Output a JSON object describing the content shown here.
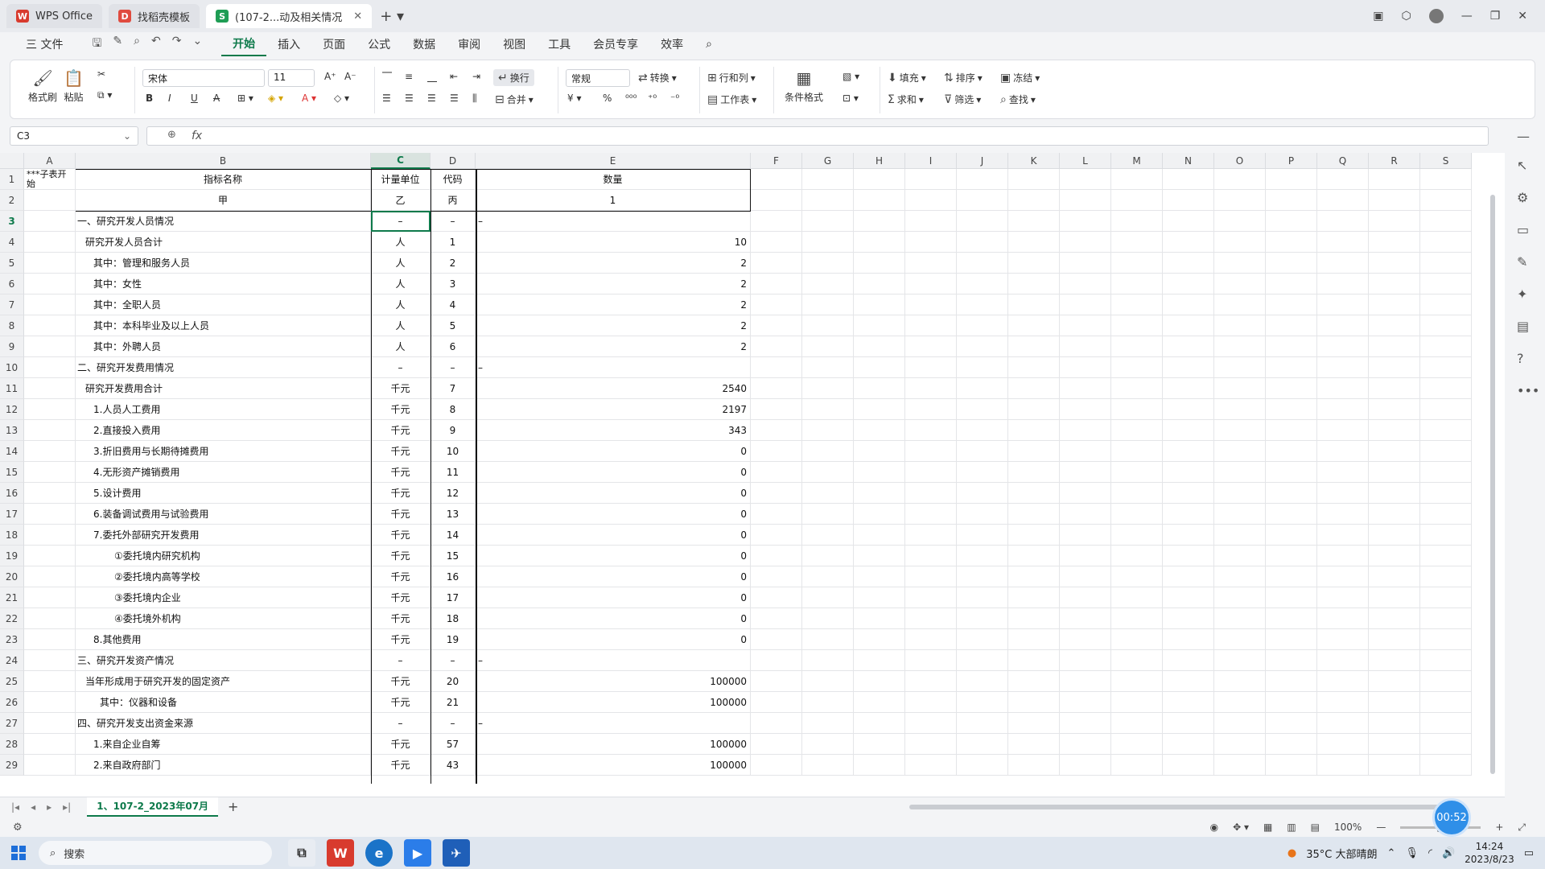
{
  "titlebar": {
    "tabs": [
      {
        "label": "WPS Office"
      },
      {
        "label": "找稻壳模板"
      },
      {
        "label": "(107-2...动及相关情况"
      }
    ]
  },
  "menu": {
    "file": "三 文件",
    "items": [
      "开始",
      "插入",
      "页面",
      "公式",
      "数据",
      "审阅",
      "视图",
      "工具",
      "会员专享",
      "效率"
    ]
  },
  "ribbon": {
    "format_painter": "格式刷",
    "paste": "粘贴",
    "font_name": "宋体",
    "font_size": "11",
    "wrap": "换行",
    "merge": "合并",
    "number_format": "常规",
    "convert": "转换",
    "row_col": "行和列",
    "worksheet": "工作表",
    "cond_format": "条件格式",
    "fill": "填充",
    "sort": "排序",
    "freeze": "冻结",
    "sum": "求和",
    "filter": "筛选",
    "find": "查找"
  },
  "formula_bar": {
    "cell_ref": "C3",
    "fx": "fx",
    "value": ""
  },
  "columns": [
    "A",
    "B",
    "C",
    "D",
    "E",
    "F",
    "G",
    "H",
    "I",
    "J",
    "K",
    "L",
    "M",
    "N",
    "O",
    "P",
    "Q",
    "R",
    "S"
  ],
  "rows": [
    {
      "n": "1",
      "a": "***子表开始",
      "b": "指标名称",
      "c": "计量单位",
      "d": "代码",
      "e": "数量"
    },
    {
      "n": "2",
      "a": "",
      "b": "甲",
      "c": "乙",
      "d": "丙",
      "e": "1"
    },
    {
      "n": "3",
      "a": "",
      "b": "一、研究开发人员情况",
      "c": "–",
      "d": "–",
      "e": "–"
    },
    {
      "n": "4",
      "a": "",
      "b": "研究开发人员合计",
      "c": "人",
      "d": "1",
      "e": "10"
    },
    {
      "n": "5",
      "a": "",
      "b": "其中：管理和服务人员",
      "c": "人",
      "d": "2",
      "e": "2"
    },
    {
      "n": "6",
      "a": "",
      "b": "其中：女性",
      "c": "人",
      "d": "3",
      "e": "2"
    },
    {
      "n": "7",
      "a": "",
      "b": "其中：全职人员",
      "c": "人",
      "d": "4",
      "e": "2"
    },
    {
      "n": "8",
      "a": "",
      "b": "其中：本科毕业及以上人员",
      "c": "人",
      "d": "5",
      "e": "2"
    },
    {
      "n": "9",
      "a": "",
      "b": "其中：外聘人员",
      "c": "人",
      "d": "6",
      "e": "2"
    },
    {
      "n": "10",
      "a": "",
      "b": "二、研究开发费用情况",
      "c": "–",
      "d": "–",
      "e": "–"
    },
    {
      "n": "11",
      "a": "",
      "b": "研究开发费用合计",
      "c": "千元",
      "d": "7",
      "e": "2540"
    },
    {
      "n": "12",
      "a": "",
      "b": "1.人员人工费用",
      "c": "千元",
      "d": "8",
      "e": "2197"
    },
    {
      "n": "13",
      "a": "",
      "b": "2.直接投入费用",
      "c": "千元",
      "d": "9",
      "e": "343"
    },
    {
      "n": "14",
      "a": "",
      "b": "3.折旧费用与长期待摊费用",
      "c": "千元",
      "d": "10",
      "e": "0"
    },
    {
      "n": "15",
      "a": "",
      "b": "4.无形资产摊销费用",
      "c": "千元",
      "d": "11",
      "e": "0"
    },
    {
      "n": "16",
      "a": "",
      "b": "5.设计费用",
      "c": "千元",
      "d": "12",
      "e": "0"
    },
    {
      "n": "17",
      "a": "",
      "b": "6.装备调试费用与试验费用",
      "c": "千元",
      "d": "13",
      "e": "0"
    },
    {
      "n": "18",
      "a": "",
      "b": "7.委托外部研究开发费用",
      "c": "千元",
      "d": "14",
      "e": "0"
    },
    {
      "n": "19",
      "a": "",
      "b": "①委托境内研究机构",
      "c": "千元",
      "d": "15",
      "e": "0"
    },
    {
      "n": "20",
      "a": "",
      "b": "②委托境内高等学校",
      "c": "千元",
      "d": "16",
      "e": "0"
    },
    {
      "n": "21",
      "a": "",
      "b": "③委托境内企业",
      "c": "千元",
      "d": "17",
      "e": "0"
    },
    {
      "n": "22",
      "a": "",
      "b": "④委托境外机构",
      "c": "千元",
      "d": "18",
      "e": "0"
    },
    {
      "n": "23",
      "a": "",
      "b": "8.其他费用",
      "c": "千元",
      "d": "19",
      "e": "0"
    },
    {
      "n": "24",
      "a": "",
      "b": "三、研究开发资产情况",
      "c": "–",
      "d": "–",
      "e": "–"
    },
    {
      "n": "25",
      "a": "",
      "b": "当年形成用于研究开发的固定资产",
      "c": "千元",
      "d": "20",
      "e": "100000"
    },
    {
      "n": "26",
      "a": "",
      "b": "其中：仪器和设备",
      "c": "千元",
      "d": "21",
      "e": "100000"
    },
    {
      "n": "27",
      "a": "",
      "b": "四、研究开发支出资金来源",
      "c": "–",
      "d": "–",
      "e": "–"
    },
    {
      "n": "28",
      "a": "",
      "b": "1.来自企业自筹",
      "c": "千元",
      "d": "57",
      "e": "100000"
    },
    {
      "n": "29",
      "a": "",
      "b": "2.来自政府部门",
      "c": "千元",
      "d": "43",
      "e": "100000"
    }
  ],
  "sheet_tab": "1、107-2_2023年07月",
  "status": {
    "zoom": "100%",
    "timer": "00:52"
  },
  "taskbar": {
    "search": "搜索",
    "weather": "35°C 大部晴朗",
    "time": "14:24",
    "date": "2023/8/23"
  }
}
